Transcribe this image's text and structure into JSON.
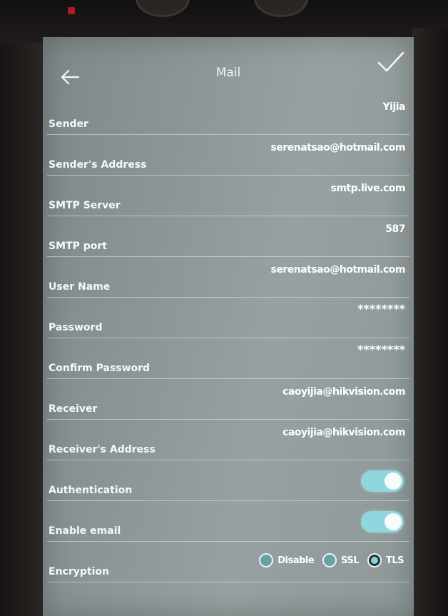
{
  "header": {
    "title": "Mail"
  },
  "fields": [
    {
      "label": "Sender",
      "value": "Yijia"
    },
    {
      "label": "Sender's Address",
      "value": "serenatsao@hotmail.com"
    },
    {
      "label": "SMTP Server",
      "value": "smtp.live.com"
    },
    {
      "label": "SMTP port",
      "value": "587"
    },
    {
      "label": "User Name",
      "value": "serenatsao@hotmail.com"
    },
    {
      "label": "Password",
      "value": "********"
    },
    {
      "label": "Confirm Password",
      "value": "********"
    },
    {
      "label": "Receiver",
      "value": "caoyijia@hikvision.com"
    },
    {
      "label": "Receiver's Address",
      "value": "caoyijia@hikvision.com"
    }
  ],
  "toggles": [
    {
      "label": "Authentication",
      "on": true
    },
    {
      "label": "Enable email",
      "on": true
    }
  ],
  "encryption": {
    "label": "Encryption",
    "options": [
      "Disable",
      "SSL",
      "TLS"
    ],
    "selected": "TLS"
  },
  "colors": {
    "toggle_on": "#8fd6df",
    "radio_selected": "#7fd8e3"
  },
  "icons": {
    "back": "arrow-left-icon",
    "confirm": "check-icon"
  }
}
